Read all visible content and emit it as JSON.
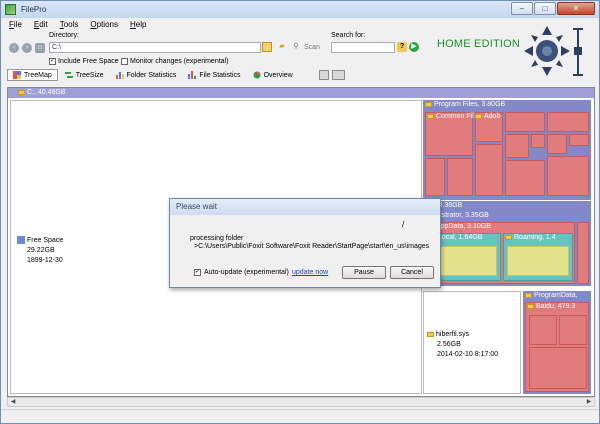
{
  "window": {
    "title": "FilePro",
    "minimize": "–",
    "maximize": "□",
    "close": "✕"
  },
  "menu": [
    "File",
    "Edit",
    "Tools",
    "Options",
    "Help"
  ],
  "toolbar": {
    "directory_label": "Directory:",
    "directory_value": "C:\\",
    "scan_label": "Scan",
    "search_label": "Search for:",
    "search_value": "",
    "help_label": "?",
    "go_label": "▶",
    "include_free_space": "Include Free Space",
    "monitor_changes": "Monitor changes (experimental)",
    "include_free_space_checked": true,
    "monitor_changes_checked": false
  },
  "edition": "HOME EDITION",
  "tabs": [
    {
      "label": "TreeMap",
      "active": true
    },
    {
      "label": "TreeSize",
      "active": false
    },
    {
      "label": "Folder Statistics",
      "active": false
    },
    {
      "label": "File Statistics",
      "active": false
    },
    {
      "label": "Overview",
      "active": false
    }
  ],
  "treemap": {
    "root": "C:, 40.48GB",
    "free_space": {
      "name": "Free Space",
      "size": "29.22GB",
      "date": "1899-12-30"
    },
    "program_files": "Program Files, 3.80GB",
    "common_files": "Common Fil",
    "adobe": "Adob",
    "users": "ers, 3.38GB",
    "administrator": "dministrator, 3.35GB",
    "appdata": "AppData, 3.10GB",
    "local": "Local, 1.64GB",
    "roaming": "Roaming, 1.4",
    "hiberfil": {
      "name": "hiberfil.sys",
      "size": "2.56GB",
      "date": "2014-02-10 8:17:00"
    },
    "programdata": "ProgramData,",
    "baidu": "Baidu, 479.3"
  },
  "dialog": {
    "title": "Please wait",
    "slash": "/",
    "line1": "processing folder",
    "line2": ">C:\\Users\\Public\\Foxit Software\\Foxit Reader\\StartPage\\start\\en_us\\images",
    "auto_update": "Auto-update (experimental)",
    "auto_update_checked": true,
    "update_link": "update now",
    "pause": "Pause",
    "cancel": "Cancel"
  },
  "colors": {
    "edition": "#1c8f2c",
    "treemap_folder": "#8389c8",
    "treemap_file": "#e27b7b",
    "link": "#1a45c0"
  },
  "scroll": {
    "left_arrow": "◀",
    "right_arrow": "▶"
  }
}
